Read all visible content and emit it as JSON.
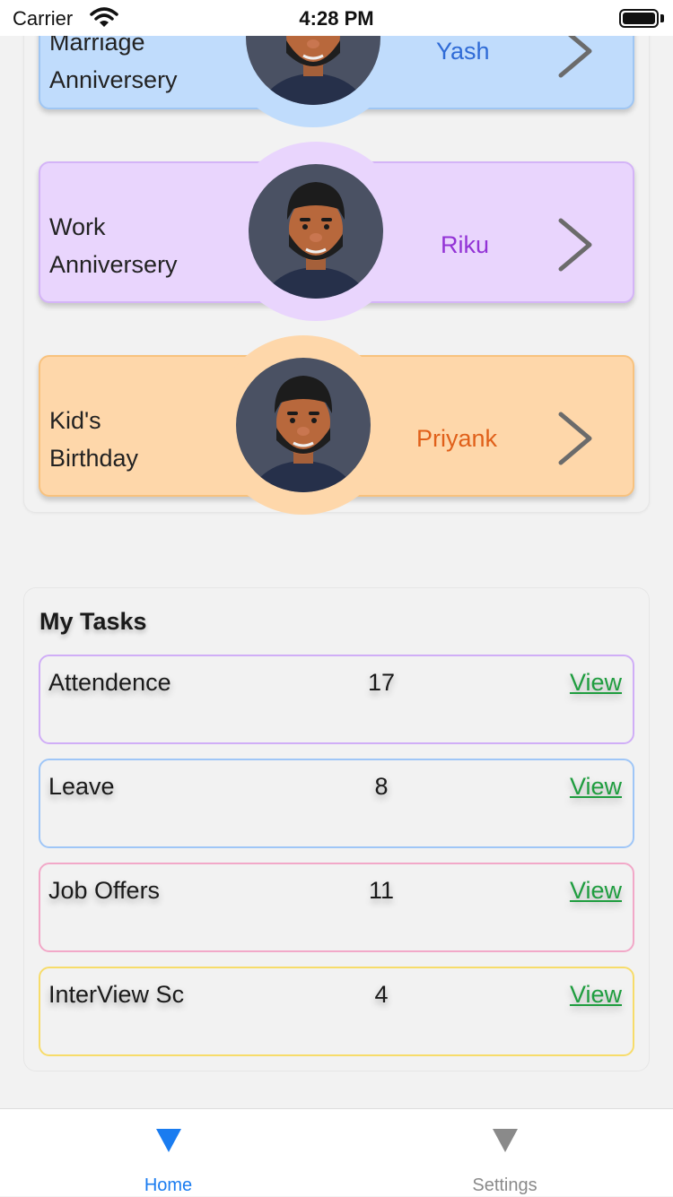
{
  "status_bar": {
    "carrier": "Carrier",
    "time": "4:28 PM"
  },
  "events": [
    {
      "label_line1": "Marriage",
      "label_line2": "Anniversery",
      "name": "Yash",
      "bg": "#c0dcfc",
      "border": "#9fc6f3",
      "halo": "#c0dcfc",
      "name_color": "#2f6bd6"
    },
    {
      "label_line1": "Work",
      "label_line2": "Anniversery",
      "name": "Riku",
      "bg": "#e9d5fd",
      "border": "#d4b4f7",
      "halo": "#e9d5fd",
      "name_color": "#9333d6"
    },
    {
      "label_line1": "Kid's",
      "label_line2": "Birthday",
      "name": "Priyank",
      "bg": "#fed7aa",
      "border": "#f8c27e",
      "halo": "#fed7aa",
      "name_color": "#e0601a"
    }
  ],
  "tasks": {
    "title": "My Tasks",
    "items": [
      {
        "name": "Attendence",
        "count": "17",
        "action": "View",
        "border": "#d0aef7"
      },
      {
        "name": "Leave",
        "count": "8",
        "action": "View",
        "border": "#9fc6f7"
      },
      {
        "name": "Job Offers",
        "count": "11",
        "action": "View",
        "border": "#f2a8c8"
      },
      {
        "name": "InterView Sc",
        "count": "4",
        "action": "View",
        "border": "#f7dc6a"
      }
    ]
  },
  "tab_bar": {
    "tabs": [
      {
        "label": "Home",
        "icon": "triangle-down-icon",
        "active": true,
        "color": "#1a7cf0"
      },
      {
        "label": "Settings",
        "icon": "triangle-down-icon",
        "active": false,
        "color": "#8a8a8a"
      }
    ]
  }
}
